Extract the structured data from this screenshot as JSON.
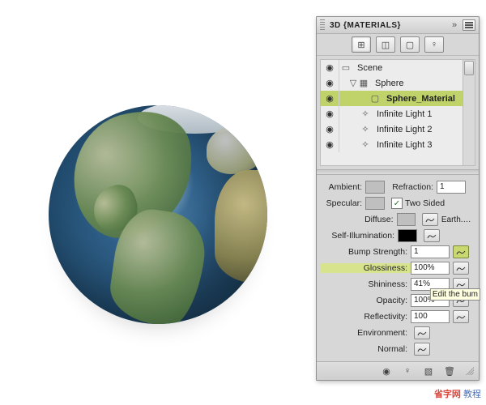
{
  "panel": {
    "title": "3D {MATERIALS}",
    "mode_tabs": [
      {
        "name": "scene-filter-icon",
        "glyph": "⊞"
      },
      {
        "name": "mesh-filter-icon",
        "glyph": "◫"
      },
      {
        "name": "material-filter-icon",
        "glyph": "▢"
      },
      {
        "name": "light-filter-icon",
        "glyph": "♀"
      }
    ],
    "tree": {
      "scene_label": "Scene",
      "items": [
        {
          "label": "Sphere",
          "type": "mesh",
          "indent": 0,
          "disclosed": true
        },
        {
          "label": "Sphere_Material",
          "type": "material",
          "indent": 1,
          "selected": true
        },
        {
          "label": "Infinite Light 1",
          "type": "light",
          "indent": 0
        },
        {
          "label": "Infinite Light 2",
          "type": "light",
          "indent": 0
        },
        {
          "label": "Infinite Light 3",
          "type": "light",
          "indent": 0
        }
      ]
    }
  },
  "props": {
    "ambient_label": "Ambient:",
    "refraction_label": "Refraction:",
    "refraction_value": "1",
    "specular_label": "Specular:",
    "two_sided_label": "Two Sided",
    "two_sided_checked": true,
    "diffuse_label": "Diffuse:",
    "diffuse_file": "Earth.psd",
    "self_illum_label": "Self-Illumination:",
    "bump_label": "Bump Strength:",
    "bump_value": "1",
    "glossiness_label": "Glossiness:",
    "glossiness_value": "100%",
    "shininess_label": "Shininess:",
    "shininess_value": "41%",
    "opacity_label": "Opacity:",
    "opacity_value": "100%",
    "reflectivity_label": "Reflectivity:",
    "reflectivity_value": "100",
    "environment_label": "Environment:",
    "normal_label": "Normal:"
  },
  "tooltip": "Edit the bum",
  "watermark_bl": "",
  "watermark_br_a": "教程",
  "watermark_br_b": "省字网"
}
